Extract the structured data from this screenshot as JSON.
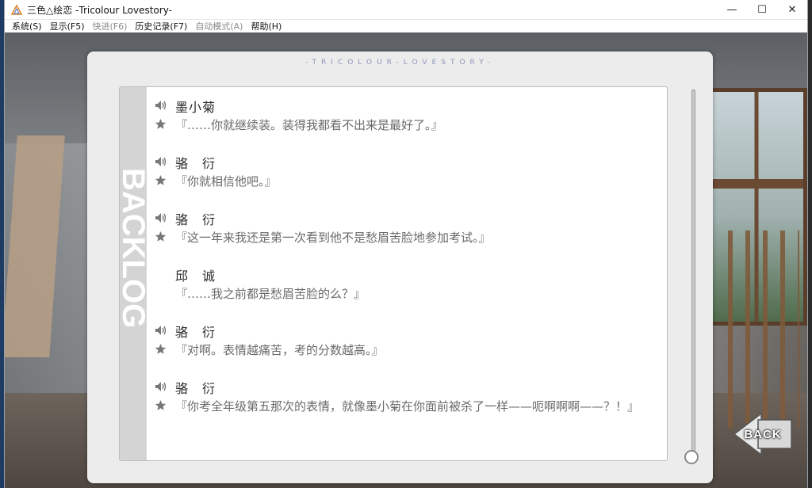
{
  "window": {
    "title": "三色△绘恋 -Tricolour Lovestory-",
    "controls": {
      "minimize": "—",
      "maximize": "☐",
      "close": "✕"
    }
  },
  "menu": [
    {
      "label": "系统(S)",
      "enabled": true
    },
    {
      "label": "显示(F5)",
      "enabled": true
    },
    {
      "label": "快进(F6)",
      "enabled": false
    },
    {
      "label": "历史记录(F7)",
      "enabled": true
    },
    {
      "label": "自动模式(A)",
      "enabled": false
    },
    {
      "label": "帮助(H)",
      "enabled": true
    }
  ],
  "backlog": {
    "header": "-TRICOLOUR-LOVESTORY-",
    "side_label": "BACKLOG",
    "entries": [
      {
        "name": "墨小菊",
        "text": "『……你就继续装。装得我都看不出来是最好了。』",
        "has_voice": true
      },
      {
        "name": "骆　衍",
        "text": "『你就相信他吧。』",
        "has_voice": true
      },
      {
        "name": "骆　衍",
        "text": "『这一年来我还是第一次看到他不是愁眉苦脸地参加考试。』",
        "has_voice": true
      },
      {
        "name": "邱　诚",
        "text": "『……我之前都是愁眉苦脸的么？』",
        "has_voice": false
      },
      {
        "name": "骆　衍",
        "text": "『对啊。表情越痛苦，考的分数越高。』",
        "has_voice": true
      },
      {
        "name": "骆　衍",
        "text": "『你考全年级第五那次的表情，就像墨小菊在你面前被杀了一样——呃啊啊啊——？！』",
        "has_voice": true
      }
    ]
  },
  "back_button": {
    "label": "BACK"
  },
  "colors": {
    "header_text": "#8a96b8",
    "panel_bg": "#ececec",
    "icon_gray": "#777777"
  }
}
